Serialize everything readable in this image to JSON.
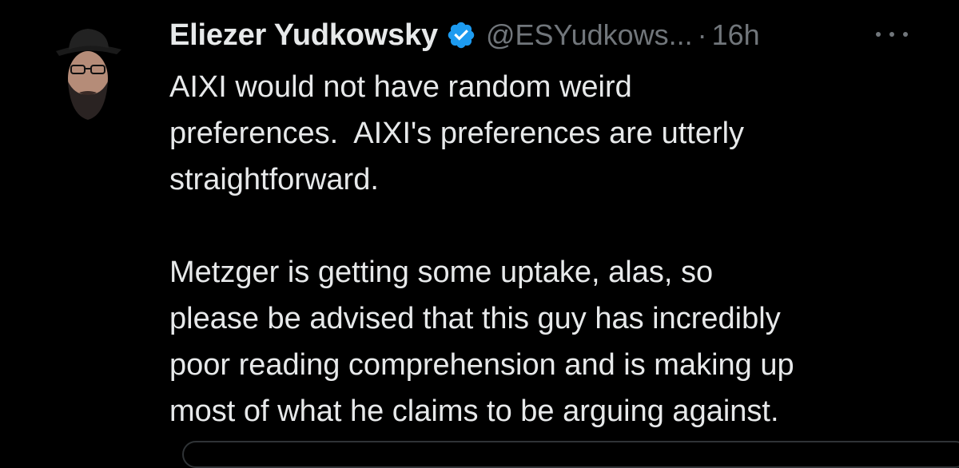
{
  "tweet": {
    "author": {
      "display_name": "Eliezer Yudkowsky",
      "handle": "@ESYudkows...",
      "verified": true,
      "avatar": "profile-photo"
    },
    "separator": "·",
    "time": "16h",
    "more_icon": "more-horizontal-icon",
    "paragraphs": [
      {
        "lines": [
          "AIXI would not have random weird",
          "preferences.  AIXI's preferences are utterly",
          "straightforward."
        ]
      },
      {
        "lines": [
          "Metzger is getting some uptake, alas, so",
          "please be advised that this guy has incredibly",
          "poor reading comprehension and is making up",
          "most of what he claims to be arguing against."
        ]
      }
    ]
  },
  "colors": {
    "background": "#000000",
    "primary_text": "#e7e9ea",
    "secondary_text": "#71767b",
    "verified_badge": "#1d9bf0",
    "border": "#2f3336"
  }
}
